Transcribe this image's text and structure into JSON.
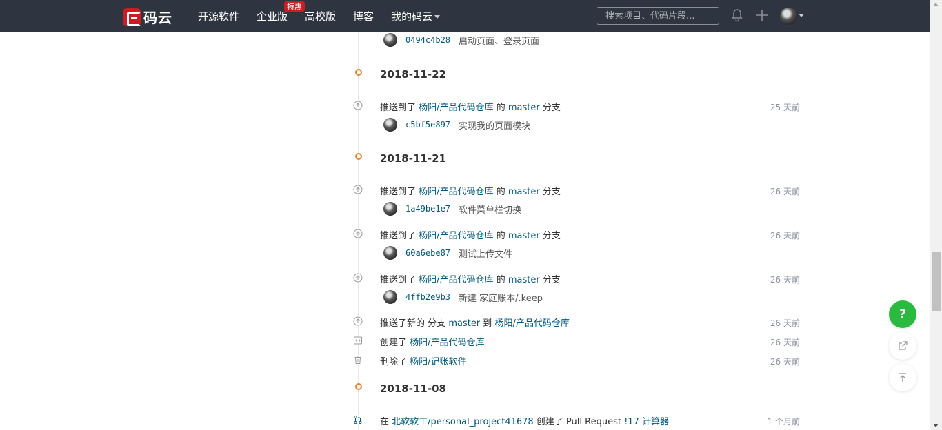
{
  "header": {
    "logo_text": "码云",
    "nav": [
      {
        "label": "开源软件"
      },
      {
        "label": "企业版",
        "badge": "特惠"
      },
      {
        "label": "高校版"
      },
      {
        "label": "博客"
      },
      {
        "label": "我的码云"
      }
    ],
    "search_placeholder": "搜索项目、代码片段..."
  },
  "timeline": {
    "top_commit": {
      "sha": "0494c4b28",
      "message": "启动页面、登录页面"
    },
    "groups": [
      {
        "date": "2018-11-22",
        "events": [
          {
            "prefix": "推送到了",
            "repo": "杨阳/产品代码仓库",
            "mid": "的",
            "branch": "master",
            "suffix": "分支",
            "time": "25 天前",
            "commit": {
              "sha": "c5bf5e897",
              "message": "实现我的页面模块"
            }
          }
        ]
      },
      {
        "date": "2018-11-21",
        "events": [
          {
            "prefix": "推送到了",
            "repo": "杨阳/产品代码仓库",
            "mid": "的",
            "branch": "master",
            "suffix": "分支",
            "time": "26 天前",
            "commit": {
              "sha": "1a49be1e7",
              "message": "软件菜单栏切换"
            }
          },
          {
            "prefix": "推送到了",
            "repo": "杨阳/产品代码仓库",
            "mid": "的",
            "branch": "master",
            "suffix": "分支",
            "time": "26 天前",
            "commit": {
              "sha": "60a6ebe87",
              "message": "测试上传文件"
            }
          },
          {
            "prefix": "推送到了",
            "repo": "杨阳/产品代码仓库",
            "mid": "的",
            "branch": "master",
            "suffix": "分支",
            "time": "26 天前",
            "commit": {
              "sha": "4ffb2e9b3",
              "message": "新建 家庭账本/.keep"
            }
          },
          {
            "prefix": "推送了新的",
            "repo": "杨阳/产品代码仓库",
            "mid": "分支",
            "branch": "master",
            "suffix": "到",
            "time": "26 天前"
          },
          {
            "prefix": "创建了",
            "repo": "杨阳/产品代码仓库",
            "time": "26 天前"
          },
          {
            "prefix": "删除了",
            "repo": "杨阳/记账软件",
            "time": "26 天前"
          }
        ]
      },
      {
        "date": "2018-11-08",
        "events": [
          {
            "prefix": "在",
            "repo": "北软软工/personal_project41678",
            "mid": "创建了 Pull Request",
            "pr": "!17 计算器",
            "time": "1 个月前"
          }
        ]
      }
    ]
  },
  "floating": {
    "help_label": "?"
  },
  "colors": {
    "header_bg": "#2e3440",
    "brand_red": "#c71d23",
    "link": "#005980",
    "date_dot": "#f0802c",
    "help_green": "#2aba3f"
  }
}
